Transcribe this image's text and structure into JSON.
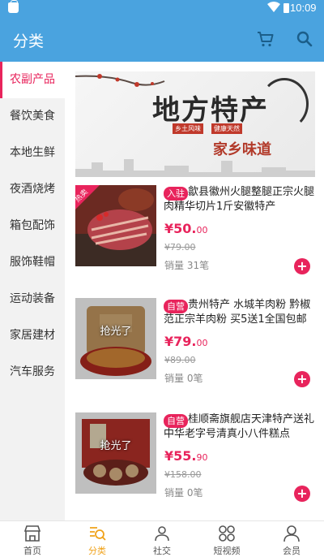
{
  "status": {
    "time": "10:09"
  },
  "header": {
    "title": "分类"
  },
  "sidebar": {
    "items": [
      {
        "label": "农副产品"
      },
      {
        "label": "餐饮美食"
      },
      {
        "label": "本地生鲜"
      },
      {
        "label": "夜酒烧烤"
      },
      {
        "label": "箱包配饰"
      },
      {
        "label": "服饰鞋帽"
      },
      {
        "label": "运动装备"
      },
      {
        "label": "家居建材"
      },
      {
        "label": "汽车服务"
      }
    ]
  },
  "banner": {
    "title": "地方特产",
    "subtitle": "家乡味道",
    "red_tag_1": "乡土风味",
    "red_tag_2": "健康天然"
  },
  "products": [
    {
      "tag": "入驻",
      "name": "歙县徽州火腿整腿正宗火腿肉精华切片1斤安徽特产",
      "price_main": "¥50.",
      "price_decimal": "00",
      "original": "¥79.00",
      "sold": "销量 31笔",
      "thumb_badge": "热卖"
    },
    {
      "tag": "自营",
      "name": "贵州特产 水城羊肉粉 黔椒范正宗羊肉粉 买5送1全国包邮",
      "price_main": "¥79.",
      "price_decimal": "00",
      "original": "¥89.00",
      "sold": "销量 0笔",
      "soldout": "抢光了"
    },
    {
      "tag": "自营",
      "name": "桂顺斋旗舰店天津特产送礼 中华老字号清真小八件糕点",
      "price_main": "¥55.",
      "price_decimal": "90",
      "original": "¥158.00",
      "sold": "销量 0笔",
      "soldout": "抢光了"
    }
  ],
  "tabbar": {
    "items": [
      {
        "label": "首页"
      },
      {
        "label": "分类"
      },
      {
        "label": "社交"
      },
      {
        "label": "短视频"
      },
      {
        "label": "会员"
      }
    ]
  },
  "colors": {
    "appbar": "#4aa3df",
    "accent": "#e8245c",
    "tab_active": "#f0a21a"
  }
}
